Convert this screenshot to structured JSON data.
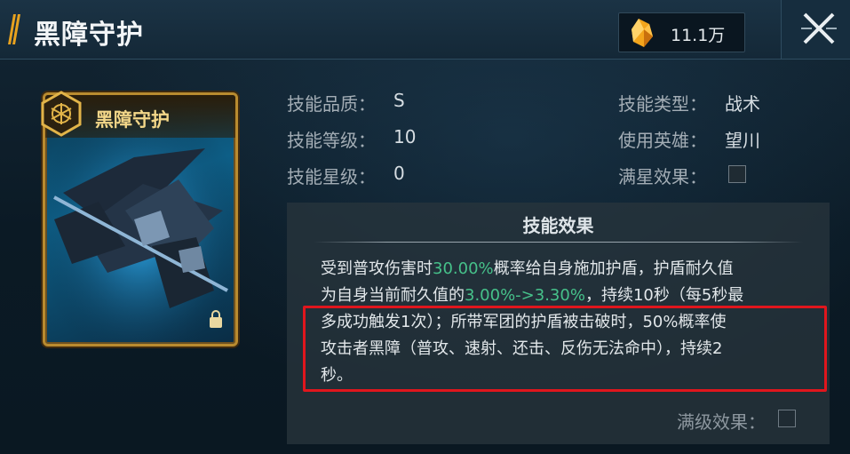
{
  "header": {
    "title": "黑障守护",
    "currency_value": "11.1万"
  },
  "card": {
    "title": "黑障守护"
  },
  "info_left": [
    {
      "label": "技能品质：",
      "value": "S"
    },
    {
      "label": "技能等级：",
      "value": "10"
    },
    {
      "label": "技能星级：",
      "value": "0"
    }
  ],
  "info_right": [
    {
      "label": "技能类型：",
      "value": "战术"
    },
    {
      "label": "使用英雄：",
      "value": "望川"
    },
    {
      "label": "满星效果：",
      "value": ""
    }
  ],
  "effect": {
    "title": "技能效果",
    "line1": {
      "a": "受到普攻伤害时",
      "b": "30.00%",
      "c": "概率给自身施加护盾，护盾耐久值"
    },
    "line2": {
      "a": "为自身当前耐久值的",
      "b": "3.00%->3.30%",
      "c": "，持续10秒（每5秒最"
    },
    "line3": "多成功触发1次）；所带军团的护盾被击破时，50%概率使",
    "line4": "攻击者黑障（普攻、速射、还击、反伤无法命中），持续2",
    "line5": "秒。",
    "max_level_label": "满级效果："
  },
  "colors": {
    "highlight": "#46c18a",
    "accent": "#e8a21f",
    "annotation_box": "#e0161d"
  }
}
